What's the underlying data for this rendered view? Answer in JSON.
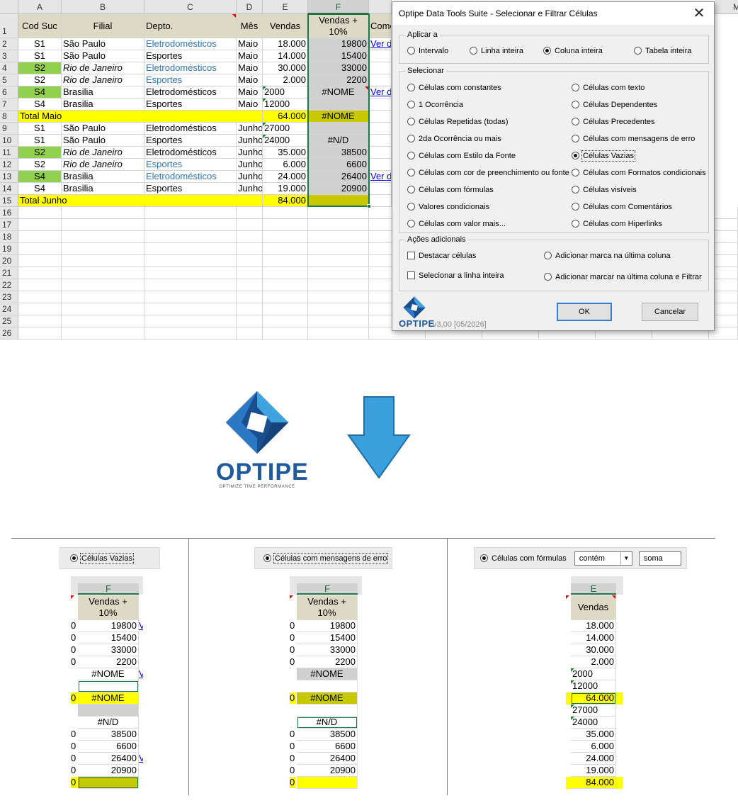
{
  "sheet": {
    "columns": [
      "A",
      "B",
      "C",
      "D",
      "E",
      "F",
      "",
      "M"
    ],
    "row_numbers": [
      "1",
      "2",
      "3",
      "4",
      "5",
      "6",
      "7",
      "8",
      "9",
      "10",
      "11",
      "12",
      "13",
      "14",
      "15",
      "16",
      "17",
      "18",
      "19",
      "20",
      "21",
      "22",
      "23",
      "24",
      "25",
      "26"
    ],
    "header": {
      "cod_suc": "Cod Suc",
      "filial": "Filial",
      "depto": "Depto.",
      "mes": "Mês",
      "vendas": "Vendas",
      "vendas10": "Vendas + 10%",
      "com": "Come"
    },
    "rows": [
      {
        "a": "S1",
        "b": "São Paulo",
        "c": "Eletrodomésticos",
        "d": "Maio",
        "e": "18.000",
        "f": "19800",
        "g": "Ver d"
      },
      {
        "a": "S1",
        "b": "São Paulo",
        "c": "Esportes",
        "d": "Maio",
        "e": "14.000",
        "f": "15400",
        "g": ""
      },
      {
        "a": "S2",
        "b": "Rio de Janeiro",
        "c": "Eletrodomésticos",
        "d": "Maio",
        "e": "30.000",
        "f": "33000",
        "g": ""
      },
      {
        "a": "S2",
        "b": "Rio de Janeiro",
        "c": "Esportes",
        "d": "Maio",
        "e": "2.000",
        "f": "2200",
        "g": ""
      },
      {
        "a": "S4",
        "b": "Brasilia",
        "c": "Eletrodomésticos",
        "d": "Maio",
        "e": "2000",
        "f": "#NOME",
        "g": "Ver d"
      },
      {
        "a": "S4",
        "b": "Brasilia",
        "c": "Esportes",
        "d": "Maio",
        "e": "12000",
        "f": "",
        "g": ""
      },
      {
        "a": "Total Maio",
        "b": "",
        "c": "",
        "d": "",
        "e": "64.000",
        "f": "#NOME",
        "g": ""
      },
      {
        "a": "S1",
        "b": "São Paulo",
        "c": "Eletrodomésticos",
        "d": "Junho",
        "e": "27000",
        "f": "",
        "g": ""
      },
      {
        "a": "S1",
        "b": "São Paulo",
        "c": "Esportes",
        "d": "Junho",
        "e": "24000",
        "f": "#N/D",
        "g": ""
      },
      {
        "a": "S2",
        "b": "Rio de Janeiro",
        "c": "Eletrodomésticos",
        "d": "Junho",
        "e": "35.000",
        "f": "38500",
        "g": ""
      },
      {
        "a": "S2",
        "b": "Rio de Janeiro",
        "c": "Esportes",
        "d": "Junho",
        "e": "6.000",
        "f": "6600",
        "g": ""
      },
      {
        "a": "S4",
        "b": "Brasilia",
        "c": "Eletrodomésticos",
        "d": "Junho",
        "e": "24.000",
        "f": "26400",
        "g": "Ver d"
      },
      {
        "a": "S4",
        "b": "Brasilia",
        "c": "Esportes",
        "d": "Junho",
        "e": "19.000",
        "f": "20900",
        "g": ""
      },
      {
        "a": "Total Junho",
        "b": "",
        "c": "",
        "d": "",
        "e": "84.000",
        "f": "",
        "g": ""
      }
    ]
  },
  "dialog": {
    "title": "Optipe Data Tools Suite - Selecionar e Filtrar Células",
    "close": "✕",
    "apply_group": "Aplicar a",
    "apply_options": [
      "Intervalo",
      "Linha inteira",
      "Coluna inteira",
      "Tabela inteira"
    ],
    "apply_selected": "Coluna inteira",
    "select_group": "Selecionar",
    "select_left": [
      "Células com constantes",
      "1 Ocorrência",
      "Células Repetidas (todas)",
      "2da Ocorrência ou mais",
      "Células com Estilo da Fonte",
      "Células com cor de preenchimento ou fonte",
      "Células com fórmulas",
      "Valores condicionais",
      "Células com valor mais..."
    ],
    "select_right": [
      "Células com texto",
      "Células Dependentes",
      "Células Precedentes",
      "Células com mensagens de erro",
      "Células Vazias",
      "Células com Formatos condicionais",
      "Células visíveis",
      "Células com Comentários",
      "Células com Hiperlinks"
    ],
    "select_selected": "Células Vazias",
    "actions_group": "Ações adicionais",
    "actions": [
      "Destacar células",
      "Selecionar a linha inteira",
      "Adicionar marca na última coluna",
      "Adicionar marcar na última coluna e Filtrar"
    ],
    "brand": "OPTIPE",
    "version": "v3,00 [05/2026]",
    "ok": "OK",
    "cancel": "Cancelar"
  },
  "logo": {
    "name": "OPTIPE",
    "tagline": "OPTIMIZE TIME PERFORMANCE",
    "colors": {
      "dark": "#1a4f8f",
      "mid": "#2c78c4",
      "light": "#3fa3e0",
      "text": "#1f5a9c"
    }
  },
  "arrow_color": "#3aa0dd",
  "panels": [
    {
      "option": "Células Vazias",
      "col_letter": "F",
      "header": "Vendas + 10%",
      "left": [
        "0",
        "0",
        "0",
        "0",
        "",
        "",
        "0",
        "",
        "",
        "0",
        "0",
        "0",
        "0",
        "0"
      ],
      "values": [
        "19800",
        "15400",
        "33000",
        "2200",
        "#NOME",
        "",
        "#NOME",
        "",
        "#N/D",
        "38500",
        "6600",
        "26400",
        "20900",
        ""
      ],
      "right_links": [
        "V",
        "",
        "",
        "",
        "V",
        "",
        "",
        "",
        "",
        "",
        "",
        "V",
        "",
        ""
      ]
    },
    {
      "option": "Células com mensagens de erro",
      "col_letter": "F",
      "header": "Vendas + 10%",
      "left": [
        "0",
        "0",
        "0",
        "0",
        "",
        "",
        "0",
        "",
        "",
        "0",
        "0",
        "0",
        "0",
        "0"
      ],
      "values": [
        "19800",
        "15400",
        "33000",
        "2200",
        "#NOME",
        "",
        "#NOME",
        "",
        "#N/D",
        "38500",
        "6600",
        "26400",
        "20900",
        ""
      ]
    },
    {
      "option": "Células com fórmulas",
      "select_value": "contém",
      "input_value": "soma",
      "col_letter": "E",
      "header": "Vendas",
      "values": [
        "18.000",
        "14.000",
        "30.000",
        "2.000",
        "2000",
        "12000",
        "64.000",
        "27000",
        "24000",
        "35.000",
        "6.000",
        "24.000",
        "19.000",
        "84.000"
      ]
    }
  ]
}
